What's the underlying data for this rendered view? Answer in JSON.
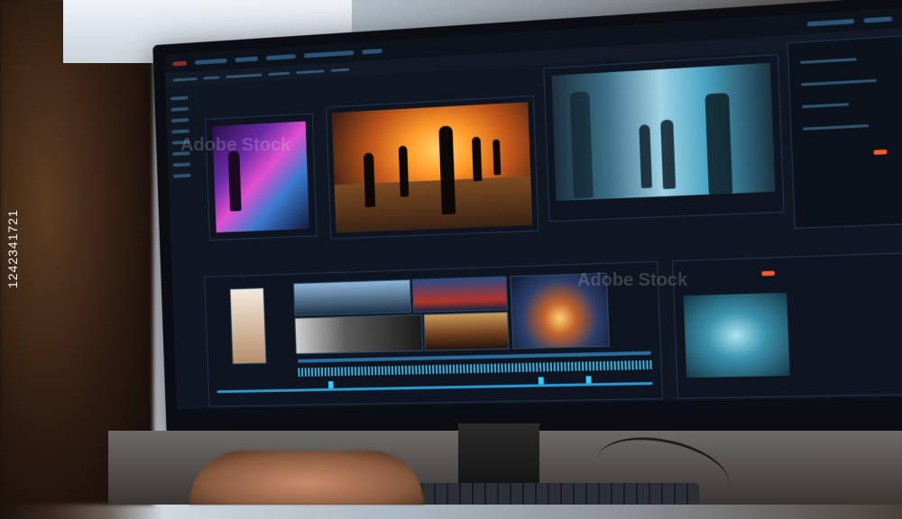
{
  "scene": {
    "description_free": true,
    "accent_colors": {
      "ui_blue": "#2a9bd6",
      "panel_bg": "#101722",
      "fire_orange": "#ff9a2a",
      "marker_red": "#ff5a2a"
    }
  },
  "watermark": {
    "image_id_text": "1242341721",
    "stock_logo_text": "Adobe Stock"
  },
  "icons": [
    "video-editor-window",
    "timeline-track",
    "preview-monitor",
    "keyboard",
    "hand"
  ]
}
